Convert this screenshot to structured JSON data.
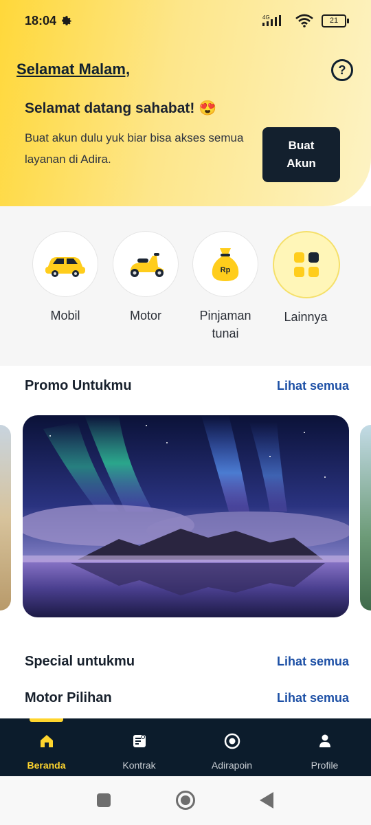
{
  "status_bar": {
    "time": "18:04",
    "network": "4G",
    "battery": "21"
  },
  "header": {
    "greeting": "Selamat Malam,",
    "help_symbol": "?"
  },
  "welcome": {
    "title": "Selamat datang sahabat! 😍",
    "body": "Buat akun dulu yuk biar bisa akses semua layanan di Adira.",
    "button_label": "Buat Akun"
  },
  "categories": [
    {
      "label": "Mobil",
      "icon": "car-icon"
    },
    {
      "label": "Motor",
      "icon": "scooter-icon"
    },
    {
      "label": "Pinjaman tunai",
      "icon": "money-bag-icon",
      "badge": "Rp"
    },
    {
      "label": "Lainnya",
      "icon": "grid-icon"
    }
  ],
  "sections": {
    "promo": {
      "title": "Promo Untukmu",
      "link": "Lihat semua"
    },
    "special": {
      "title": "Special untukmu",
      "link": "Lihat semua"
    },
    "motor": {
      "title": "Motor Pilihan",
      "link": "Lihat semua"
    }
  },
  "bottom_nav": [
    {
      "label": "Beranda",
      "icon": "home-icon",
      "active": true
    },
    {
      "label": "Kontrak",
      "icon": "contract-icon",
      "active": false
    },
    {
      "label": "Adirapoin",
      "icon": "points-icon",
      "active": false
    },
    {
      "label": "Profile",
      "icon": "profile-icon",
      "active": false
    }
  ],
  "colors": {
    "accent": "#ffd52e",
    "nav_bg": "#0c1c2c",
    "link": "#1c4fa5",
    "button_bg": "#13202e"
  }
}
